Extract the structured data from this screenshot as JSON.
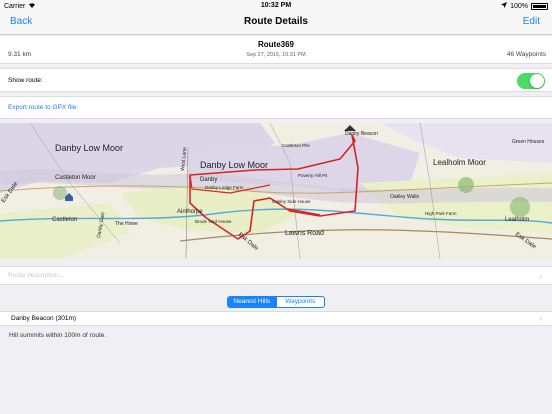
{
  "status_bar": {
    "carrier": "Carrier",
    "time": "10:32 PM",
    "battery": "100%"
  },
  "nav": {
    "back_label": "Back",
    "title": "Route Details",
    "edit_label": "Edit"
  },
  "route": {
    "name": "Route369",
    "date": "Sep 27, 2016, 10:31 PM",
    "distance": "9.31 km",
    "waypoints": "46 Waypoints"
  },
  "settings": {
    "show_route_label": "Show route:",
    "show_route_on": true,
    "export_label": "Export route to GPX file"
  },
  "map": {
    "labels": {
      "danby_low_moor_left": "Danby Low Moor",
      "castleton_moor": "Castleton Moor",
      "danby_low_moor_center": "Danby Low Moor",
      "lealholm_moor": "Lealholm Moor",
      "castleton": "Castleton",
      "danby": "Danby",
      "ainthorpe": "Ainthorpe",
      "lealholm": "Lealholm",
      "lawns_road": "Lawns Road",
      "esk_dale_right": "Esk Dale",
      "esk_dale_center": "Esk Dale",
      "esk_dale_left": "Esk Dale",
      "danby_beacon": "Danby Beacon",
      "west_lane": "West Lane",
      "danby_dale": "Danby Dale",
      "oakley_walls": "Oakley Walls",
      "green_houses": "Green Houses",
      "high_park_farm": "High Park Farm",
      "oakley_side_house": "Oakley Side House",
      "poverty_hill_pit": "Poverty Hill Pit",
      "castleton_pits": "Castleton Pits",
      "the_howe": "The Howe",
      "brook_yard_house": "Brook Yard House",
      "danby_lodge_farm": "Danby Lodge Farm"
    },
    "colors": {
      "route": "#d62424",
      "moor": "#d9d3e6",
      "field": "#ecf1c8",
      "water": "#5aa7d8"
    }
  },
  "description": {
    "placeholder": "Route description..."
  },
  "tabs": {
    "nearest_hills": "Nearest Hills",
    "waypoints": "Waypoints",
    "active": "nearest_hills"
  },
  "hills": [
    {
      "label": "Danby Beacon (301m)"
    }
  ],
  "hill_note": "Hill summits within 100m of route."
}
